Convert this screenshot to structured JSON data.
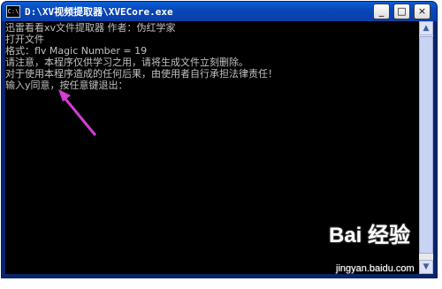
{
  "window": {
    "title": "D:\\XV视频提取器\\XVECore.exe",
    "icon_label": "C:\\"
  },
  "title_buttons": {
    "minimize": "_",
    "maximize": "□",
    "close": "×"
  },
  "console": {
    "lines": [
      "迅雷看看xv文件提取器 作者：伪红学家",
      "打开文件",
      "格式：flv  Magic Number = 19",
      "请注意，本程序仅供学习之用，请将生成文件立刻删除。",
      "对于使用本程序造成的任何后果，由使用者自行承担法律责任！",
      "输入y同意，按任意键退出："
    ]
  },
  "scrollbar": {
    "up_arrow": "▲",
    "down_arrow": "▼"
  },
  "annotation": {
    "arrow_color": "#d63cd6"
  },
  "watermark": {
    "logo": "Bai 经验",
    "url": "jingyan.baidu.com"
  }
}
